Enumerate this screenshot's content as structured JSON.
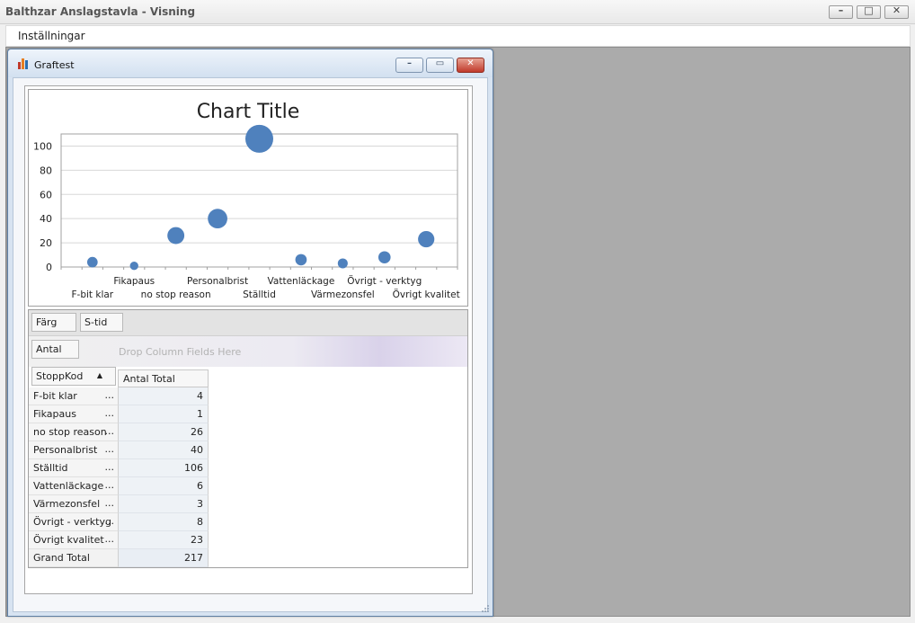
{
  "window": {
    "title": "Balthzar Anslagstavla - Visning",
    "minimize": "–",
    "maximize": "□",
    "close": "✕"
  },
  "menu": {
    "items": [
      {
        "label": "Inställningar"
      }
    ]
  },
  "child": {
    "title": "Graftest",
    "icon": "bar-chart-icon",
    "minimize": "–",
    "maximize": "▭",
    "close": "✕"
  },
  "chart_data": {
    "type": "scatter",
    "title": "Chart Title",
    "categories": [
      "F-bit klar",
      "Fikapaus",
      "no stop reason",
      "Personalbrist",
      "Ställtid",
      "Vattenläckage",
      "Värmezonsfel",
      "Övrigt - verktyg",
      "Övrigt kvalitet"
    ],
    "values": [
      4,
      1,
      26,
      40,
      106,
      6,
      3,
      8,
      23
    ],
    "ylim": [
      0,
      110
    ],
    "yticks": [
      0,
      20,
      40,
      60,
      80,
      100
    ],
    "grid": true,
    "bubble": true,
    "color": "#4f81bd"
  },
  "pivot": {
    "filter_fields": [
      "Färg",
      "S-tid"
    ],
    "data_field": "Antal",
    "drop_hint": "Drop Column Fields Here",
    "row_field": "StoppKod",
    "sort_icon": "sort-ascending-icon",
    "column_header": "Antal Total",
    "ellipsis": "...",
    "rows": [
      {
        "label": "F-bit klar",
        "value": "4"
      },
      {
        "label": "Fikapaus",
        "value": "1"
      },
      {
        "label": "no stop reason",
        "value": "26"
      },
      {
        "label": "Personalbrist",
        "value": "40"
      },
      {
        "label": "Ställtid",
        "value": "106"
      },
      {
        "label": "Vattenläckage",
        "value": "6"
      },
      {
        "label": "Värmezonsfel",
        "value": "3"
      },
      {
        "label": "Övrigt - verktyg",
        "value": "8"
      },
      {
        "label": "Övrigt kvalitet",
        "value": "23"
      }
    ],
    "grand_total_label": "Grand Total",
    "grand_total_value": "217"
  }
}
